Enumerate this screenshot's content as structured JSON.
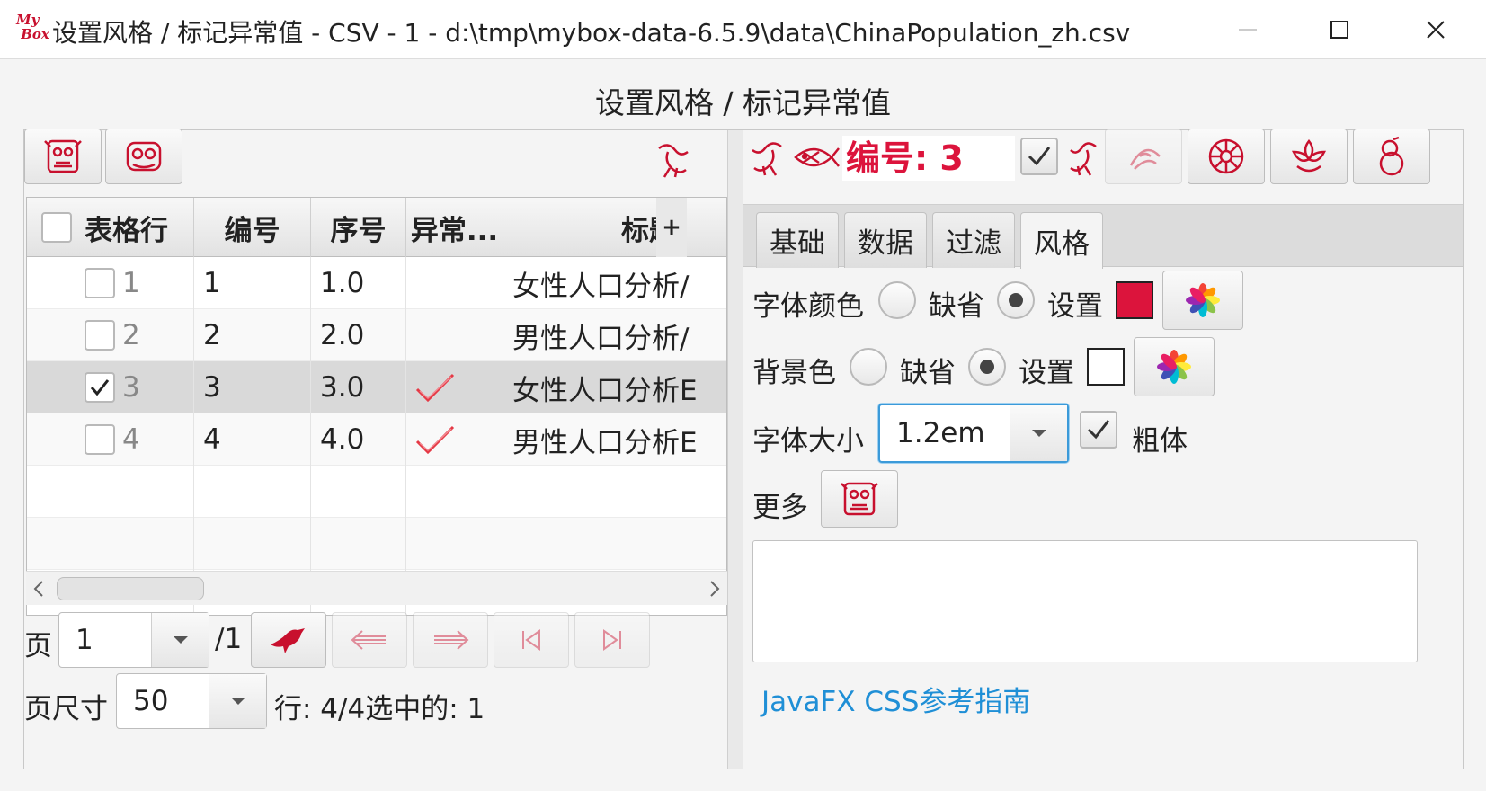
{
  "window": {
    "logo_text": "My Box",
    "title": "设置风格 / 标记异常值 - CSV - 1 - d:\\tmp\\mybox-data-6.5.9\\data\\ChinaPopulation_zh.csv"
  },
  "dialog": {
    "heading": "设置风格 / 标记异常值"
  },
  "table": {
    "columns": [
      "表格行",
      "编号",
      "序号",
      "异常...",
      "标题"
    ],
    "rows": [
      {
        "table_row": "1",
        "id": "1",
        "seq": "1.0",
        "abnormal": false,
        "title": "女性人口分析/",
        "checked": false
      },
      {
        "table_row": "2",
        "id": "2",
        "seq": "2.0",
        "abnormal": false,
        "title": "男性人口分析/",
        "checked": false
      },
      {
        "table_row": "3",
        "id": "3",
        "seq": "3.0",
        "abnormal": true,
        "title": "女性人口分析E",
        "checked": true
      },
      {
        "table_row": "4",
        "id": "4",
        "seq": "4.0",
        "abnormal": true,
        "title": "男性人口分析E",
        "checked": false
      }
    ]
  },
  "pagination": {
    "page_label": "页",
    "page_value": "1",
    "page_total": "/1",
    "pagesize_label": "页尺寸",
    "pagesize_value": "50",
    "status": "行: 4/4选中的: 1"
  },
  "style_panel": {
    "current_label": "编号: 3",
    "tabs": [
      "基础",
      "数据",
      "过滤",
      "风格"
    ],
    "active_tab": "风格",
    "font_color_label": "字体颜色",
    "bg_color_label": "背景色",
    "default_label": "缺省",
    "set_label": "设置",
    "font_color": "#dc143c",
    "bg_color": "#ffffff",
    "font_size_label": "字体大小",
    "font_size_value": "1.2em",
    "bold_label": "粗体",
    "more_label": "更多",
    "css_link": "JavaFX CSS参考指南"
  },
  "colors": {
    "accent": "#c8102e",
    "link": "#1f8fd6"
  }
}
